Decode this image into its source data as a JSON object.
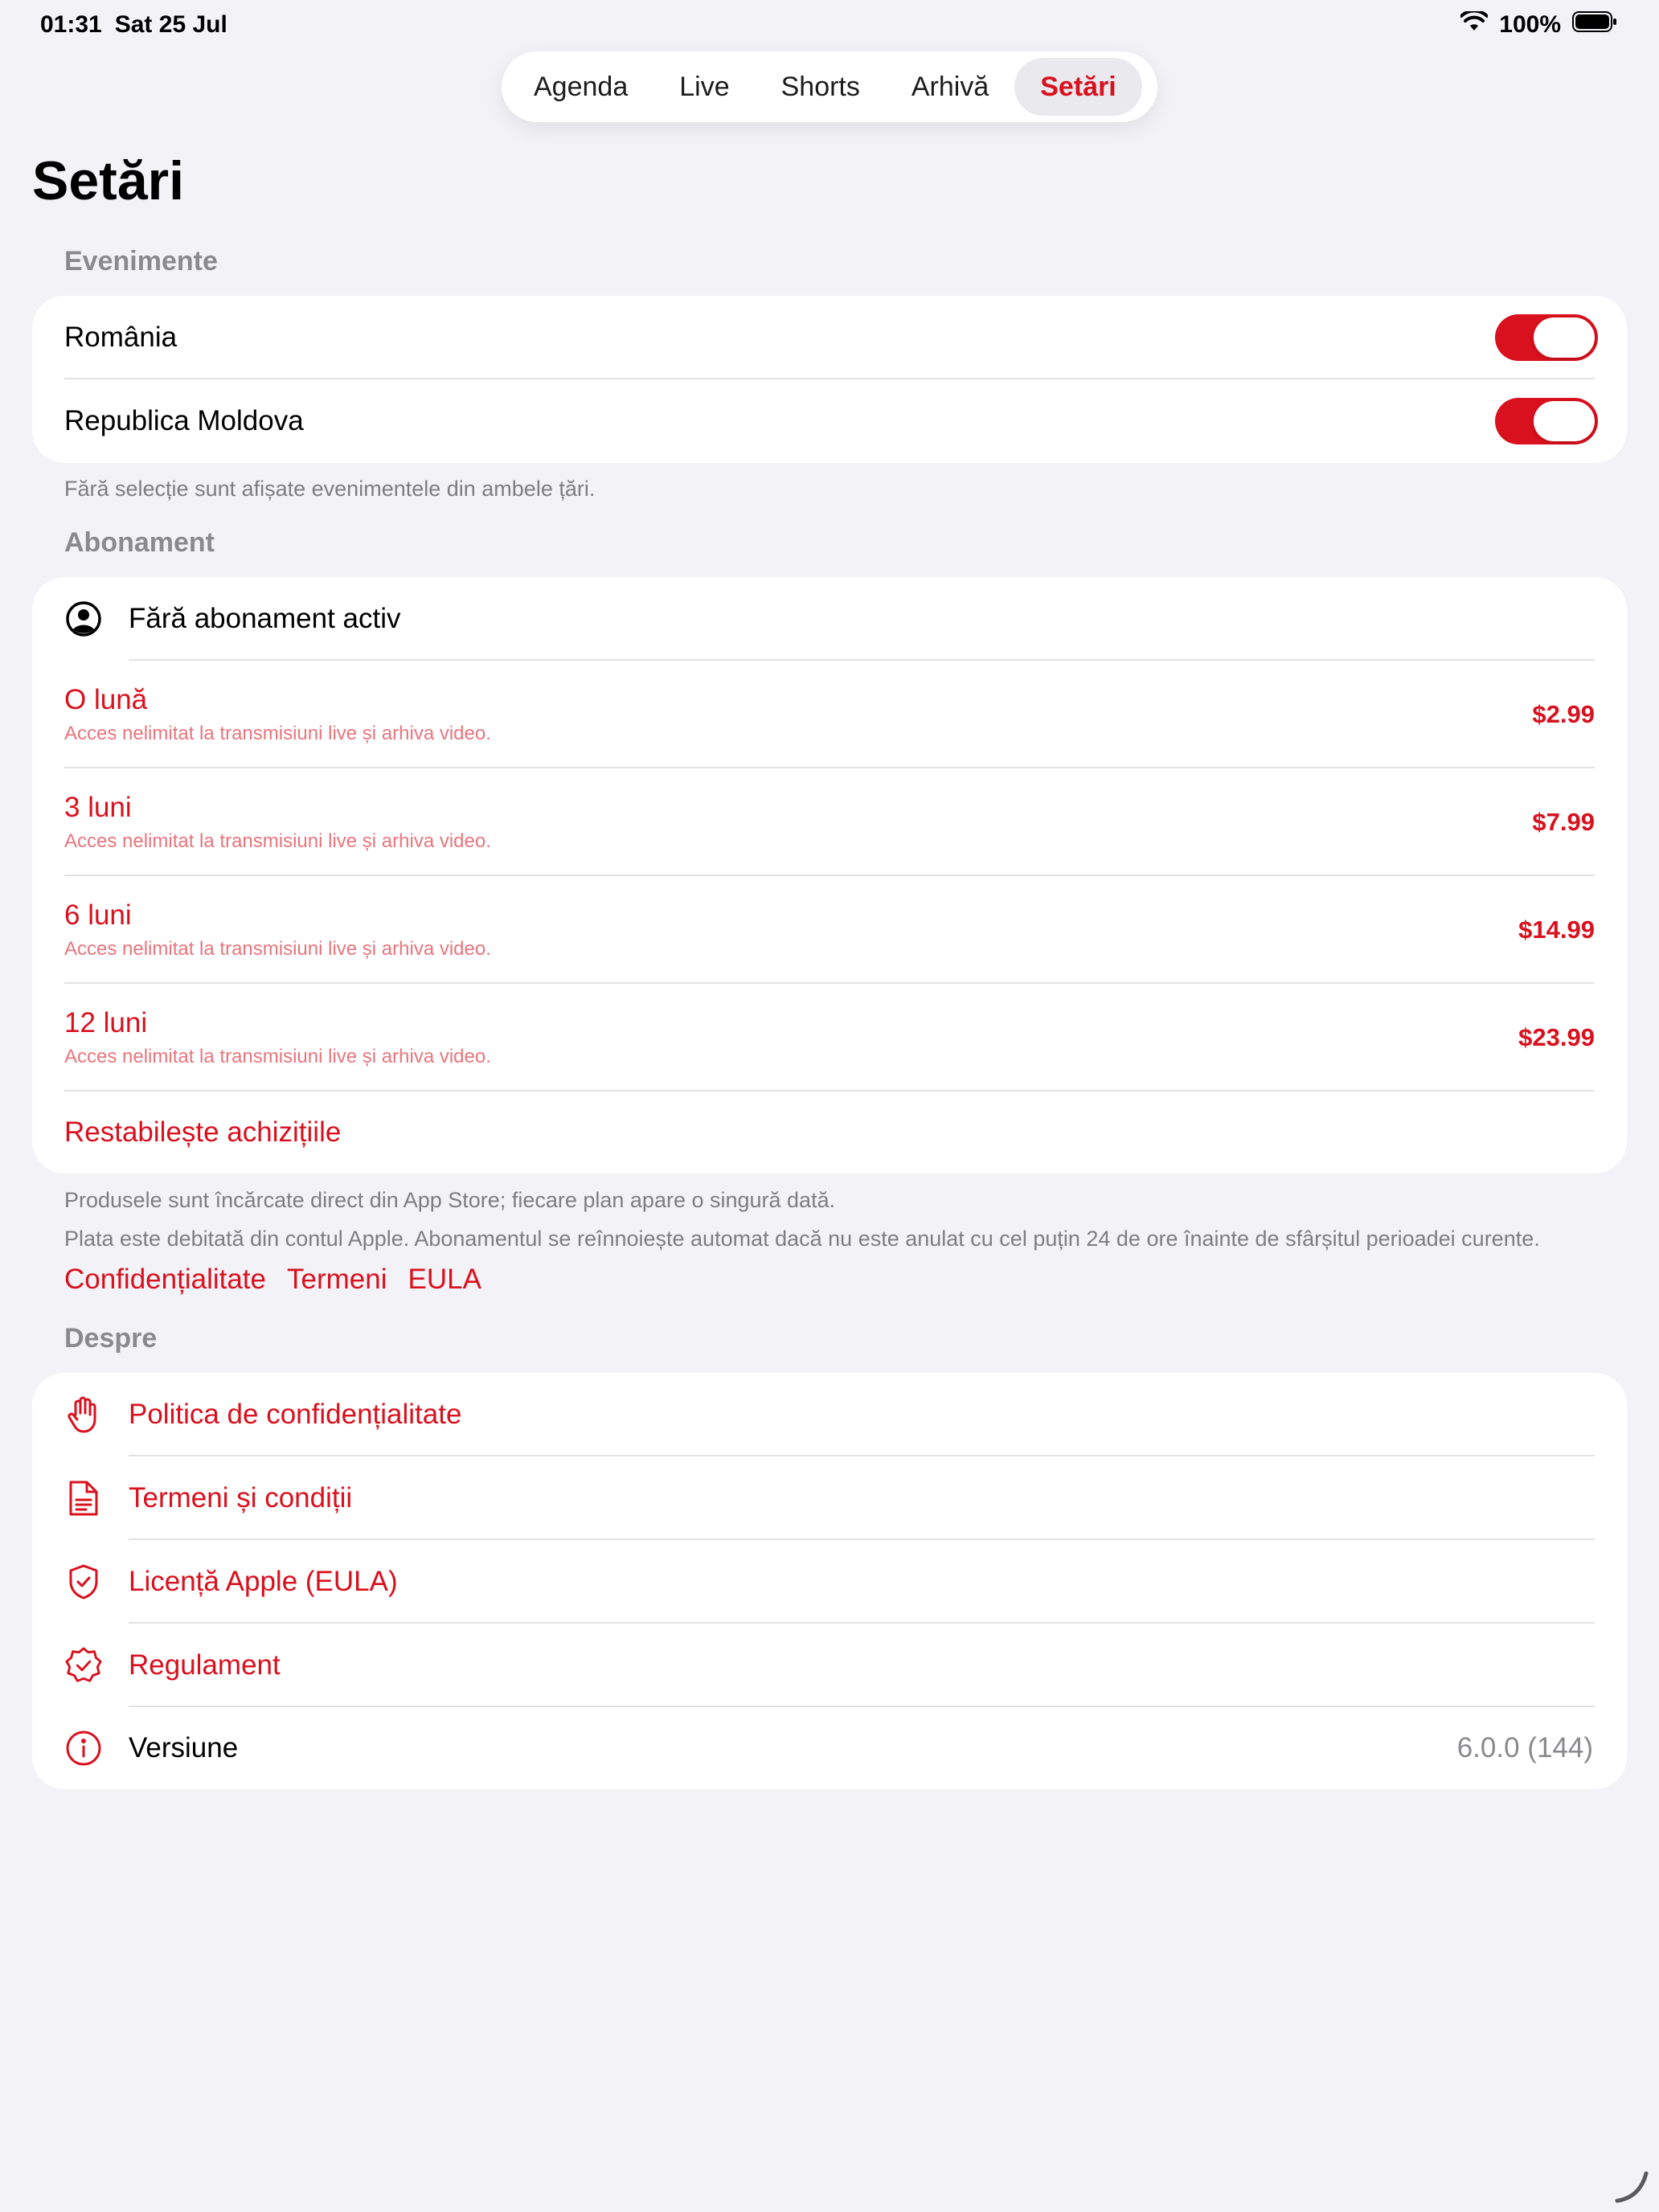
{
  "status": {
    "time": "01:31",
    "date": "Sat 25 Jul",
    "battery": "100%"
  },
  "tabs": [
    {
      "label": "Agenda"
    },
    {
      "label": "Live"
    },
    {
      "label": "Shorts"
    },
    {
      "label": "Arhivă"
    },
    {
      "label": "Setări",
      "active": true
    }
  ],
  "title": "Setări",
  "events": {
    "section": "Evenimente",
    "items": [
      {
        "label": "România",
        "on": true
      },
      {
        "label": "Republica Moldova",
        "on": true
      }
    ],
    "note": "Fără selecție sunt afișate evenimentele din ambele țări."
  },
  "subscription": {
    "section": "Abonament",
    "status": "Fără abonament activ",
    "plans": [
      {
        "title": "O lună",
        "subtitle": "Acces nelimitat la transmisiuni live și arhiva video.",
        "price": "$2.99"
      },
      {
        "title": "3 luni",
        "subtitle": "Acces nelimitat la transmisiuni live și arhiva video.",
        "price": "$7.99"
      },
      {
        "title": "6 luni",
        "subtitle": "Acces nelimitat la transmisiuni live și arhiva video.",
        "price": "$14.99"
      },
      {
        "title": "12 luni",
        "subtitle": "Acces nelimitat la transmisiuni live și arhiva video.",
        "price": "$23.99"
      }
    ],
    "restore": "Restabilește achizițiile",
    "note1": "Produsele sunt încărcate direct din App Store; fiecare plan apare o singură dată.",
    "note2": "Plata este debitată din contul Apple. Abonamentul se reînnoiește automat dacă nu este anulat cu cel puțin 24 de ore înainte de sfârșitul perioadei curente.",
    "links": [
      "Confidențialitate",
      "Termeni",
      "EULA"
    ]
  },
  "about": {
    "section": "Despre",
    "items": [
      {
        "label": "Politica de confidențialitate",
        "icon": "hand-raised-icon"
      },
      {
        "label": "Termeni și condiții",
        "icon": "document-icon"
      },
      {
        "label": "Licență Apple (EULA)",
        "icon": "shield-check-icon"
      },
      {
        "label": "Regulament",
        "icon": "badge-check-icon"
      }
    ],
    "version_label": "Versiune",
    "version_value": "6.0.0 (144)"
  },
  "colors": {
    "accent": "#d9101d",
    "background": "#f2f2f7"
  }
}
